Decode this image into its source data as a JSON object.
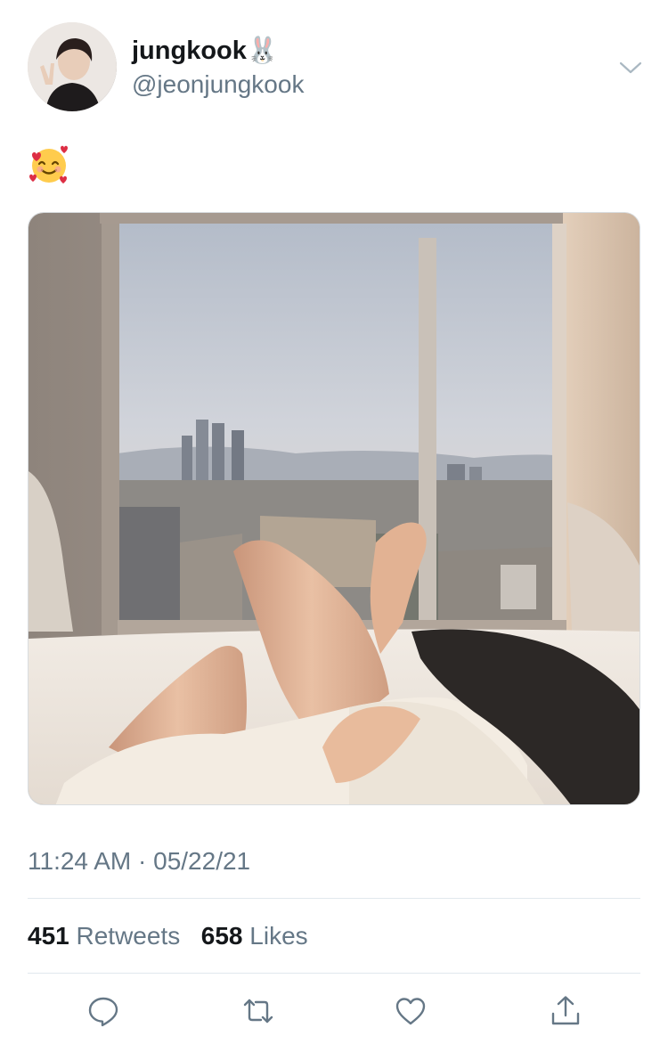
{
  "tweet": {
    "author": {
      "display_name": "jungkook",
      "name_emoji": "🐰",
      "handle": "@jeonjungkook"
    },
    "text_emoji": "🥰",
    "time": "11:24 AM",
    "separator": "·",
    "date": "05/22/21",
    "stats": {
      "retweets_count": "451",
      "retweets_label": "Retweets",
      "likes_count": "658",
      "likes_label": "Likes"
    }
  },
  "actions": [
    {
      "name": "reply",
      "icon": "reply-icon"
    },
    {
      "name": "retweet",
      "icon": "retweet-icon"
    },
    {
      "name": "like",
      "icon": "heart-icon"
    },
    {
      "name": "share",
      "icon": "share-icon"
    }
  ],
  "colors": {
    "secondary_text": "#657786",
    "primary_text": "#14171a",
    "divider": "#e1e8ed"
  }
}
